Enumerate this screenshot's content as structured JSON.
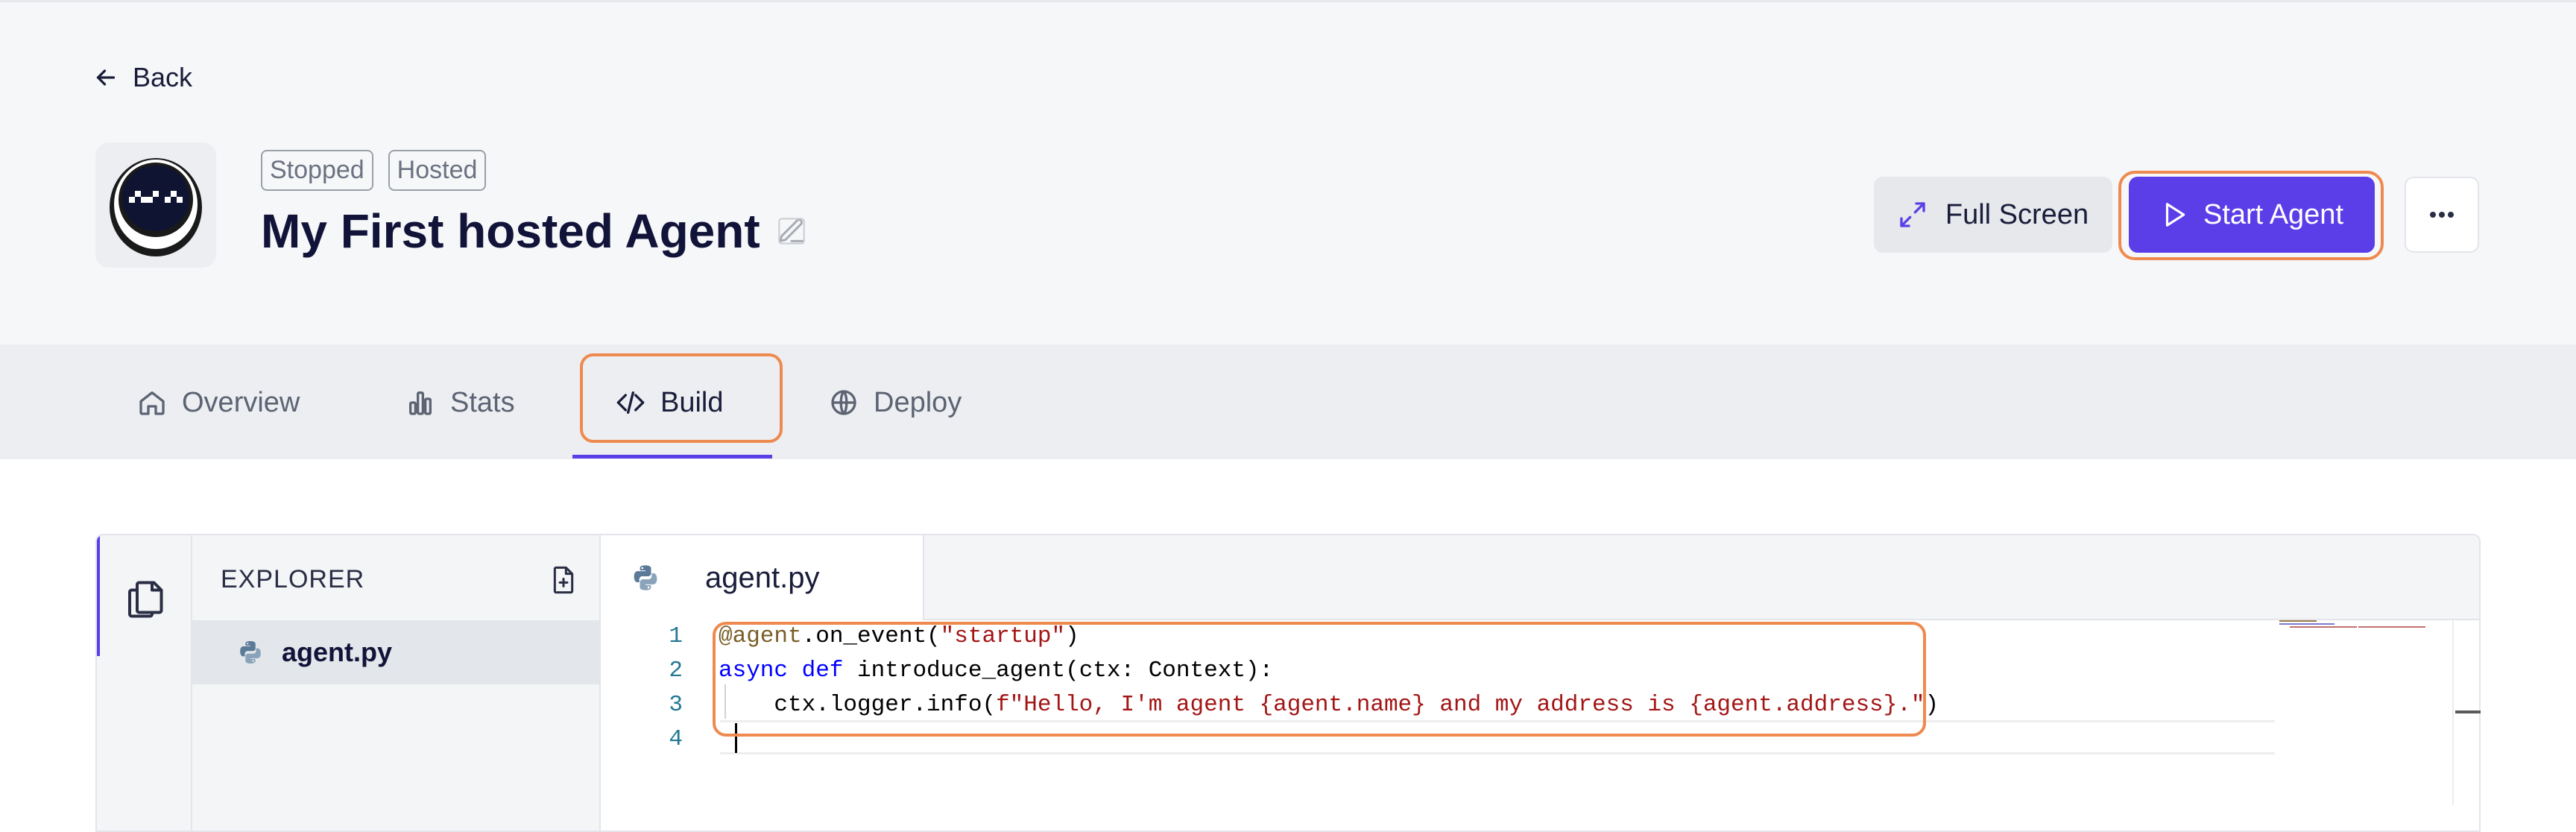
{
  "header": {
    "back_label": "Back",
    "badges": [
      "Stopped",
      "Hosted"
    ],
    "agent_name": "My First hosted Agent",
    "buttons": {
      "full_screen": "Full Screen",
      "start_agent": "Start Agent"
    }
  },
  "tabs": [
    {
      "label": "Overview",
      "icon": "home-icon"
    },
    {
      "label": "Stats",
      "icon": "bar-chart-icon"
    },
    {
      "label": "Build",
      "icon": "code-icon"
    },
    {
      "label": "Deploy",
      "icon": "globe-icon"
    }
  ],
  "editor": {
    "explorer_title": "EXPLORER",
    "files": [
      "agent.py"
    ],
    "open_tab": "agent.py",
    "line_numbers": [
      "1",
      "2",
      "3",
      "4"
    ],
    "code_lines": [
      "@agent.on_event(\"startup\")",
      "async def introduce_agent(ctx: Context):",
      "    ctx.logger.info(f\"Hello, I'm agent {agent.name} and my address is {agent.address}.\")",
      ""
    ]
  },
  "colors": {
    "accent": "#5b3ee8",
    "highlight_ring": "#ee8a4f",
    "header_bg": "#f6f7f9",
    "tabs_bg": "#eceef2"
  }
}
